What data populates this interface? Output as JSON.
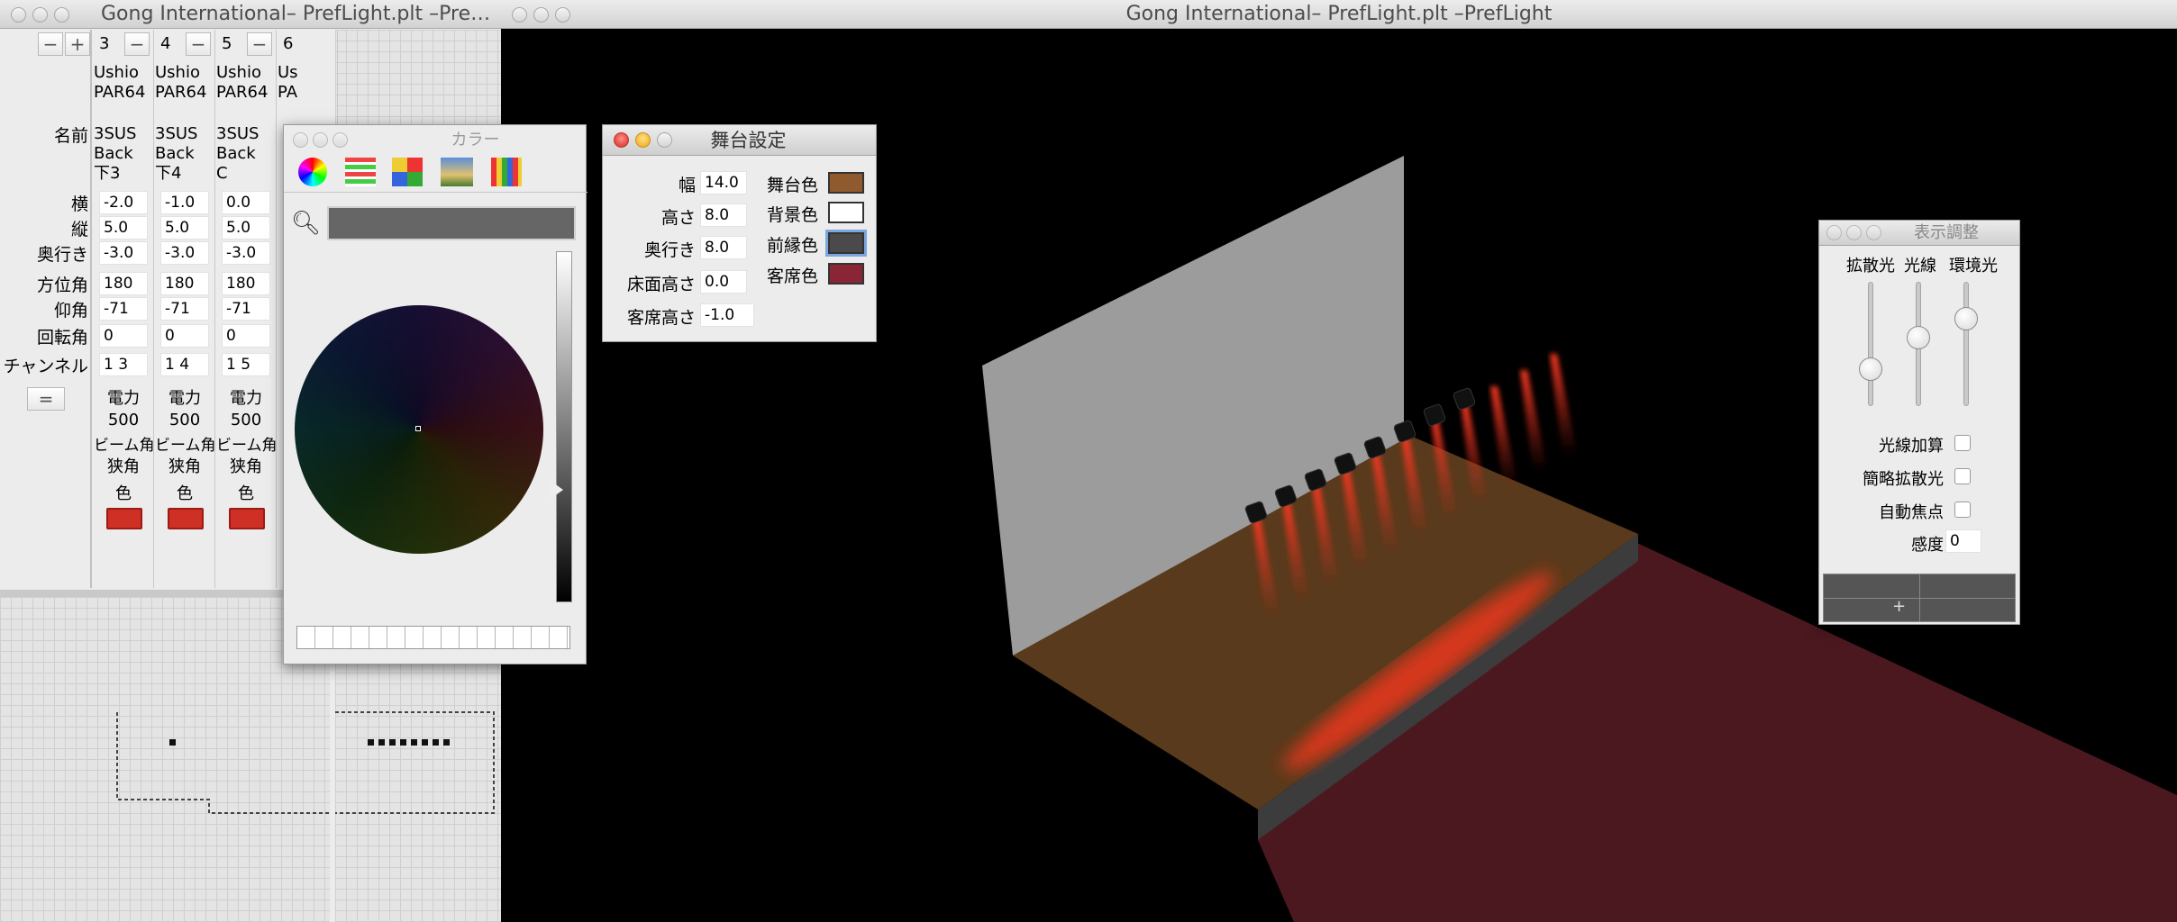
{
  "main_window": {
    "title": "Gong International– PrefLight.plt –PrefLight"
  },
  "left_window": {
    "title": "Gong International– PrefLight.plt –Pre…"
  },
  "fixture_table": {
    "minus": "−",
    "plus": "+",
    "eq": "=",
    "row_labels": {
      "name": "名前",
      "x": "横",
      "y": "縦",
      "depth": "奥行き",
      "azimuth": "方位角",
      "elevation": "仰角",
      "rotation": "回転角",
      "channel": "チャンネル"
    },
    "columns": [
      {
        "num": "3",
        "model1": "Ushio",
        "model2": "PAR64",
        "name1": "3SUS",
        "name2": "Back",
        "name3": "下3",
        "x": "-2.0",
        "y": "5.0",
        "depth": "-3.0",
        "azimuth": "180",
        "elevation": "-71",
        "rotation": "0",
        "channel": "1 3",
        "power_label": "電力",
        "power": "500",
        "beam_label": "ビーム角",
        "beam": "狭角",
        "color_label": "色"
      },
      {
        "num": "4",
        "model1": "Ushio",
        "model2": "PAR64",
        "name1": "3SUS",
        "name2": "Back",
        "name3": "下4",
        "x": "-1.0",
        "y": "5.0",
        "depth": "-3.0",
        "azimuth": "180",
        "elevation": "-71",
        "rotation": "0",
        "channel": "1 4",
        "power_label": "電力",
        "power": "500",
        "beam_label": "ビーム角",
        "beam": "狭角",
        "color_label": "色"
      },
      {
        "num": "5",
        "model1": "Ushio",
        "model2": "PAR64",
        "name1": "3SUS",
        "name2": "Back",
        "name3": "C",
        "x": "0.0",
        "y": "5.0",
        "depth": "-3.0",
        "azimuth": "180",
        "elevation": "-71",
        "rotation": "0",
        "channel": "1 5",
        "power_label": "電力",
        "power": "500",
        "beam_label": "ビーム角",
        "beam": "狭角",
        "color_label": "色"
      },
      {
        "num": "6",
        "model1": "Us",
        "model2": "PA"
      }
    ]
  },
  "color_panel": {
    "title": "カラー",
    "search_value": ""
  },
  "stage_panel": {
    "title": "舞台設定",
    "width_label": "幅",
    "width": "14.0",
    "height_label": "高さ",
    "height": "8.0",
    "depth_label": "奥行き",
    "depth": "8.0",
    "floor_label": "床面高さ",
    "floor": "0.0",
    "seat_label": "客席高さ",
    "seat": "-1.0",
    "stage_color_label": "舞台色",
    "bg_color_label": "背景色",
    "front_color_label": "前縁色",
    "seat_color_label": "客席色",
    "colors": {
      "stage": "#8f5a2e",
      "bg": "#ffffff",
      "front": "#4a4a4a",
      "seat": "#8a2535"
    }
  },
  "display_panel": {
    "title": "表示調整",
    "diffuse_label": "拡散光",
    "light_label": "光線",
    "ambient_label": "環境光",
    "diffuse_level": 0.3,
    "light_level": 0.55,
    "ambient_level": 0.7,
    "additive_label": "光線加算",
    "simple_diffuse_label": "簡略拡散光",
    "autofocus_label": "自動焦点",
    "sensitivity_label": "感度",
    "sensitivity": "0",
    "plus": "+"
  },
  "scene": {
    "fixture_count": 8,
    "beam_color": "#d92a1a"
  }
}
